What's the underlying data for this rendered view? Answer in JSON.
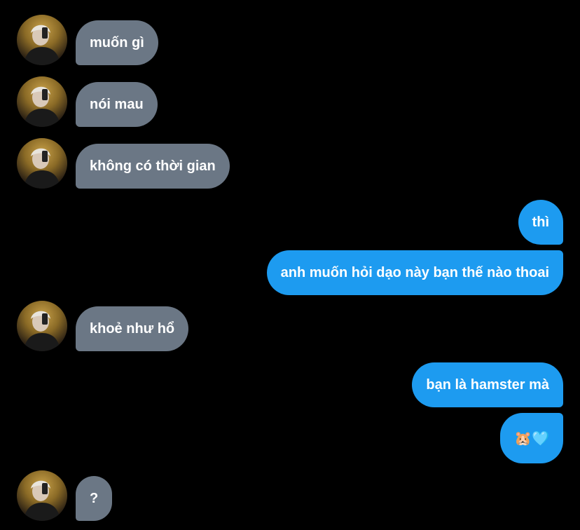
{
  "colors": {
    "background": "#000000",
    "incoming_bubble": "#6b7785",
    "outgoing_bubble": "#1d9bf0",
    "text": "#ffffff"
  },
  "messages": [
    {
      "direction": "incoming",
      "text": "muốn gì"
    },
    {
      "direction": "incoming",
      "text": "nói mau"
    },
    {
      "direction": "incoming",
      "text": "không có thời gian"
    },
    {
      "direction": "outgoing",
      "text": "thì"
    },
    {
      "direction": "outgoing",
      "text": "anh muốn hỏi dạo này bạn thế nào thoai"
    },
    {
      "direction": "incoming",
      "text": "khoẻ như hổ"
    },
    {
      "direction": "outgoing",
      "text": "bạn là hamster mà"
    },
    {
      "direction": "outgoing",
      "text": "🐹🩵"
    },
    {
      "direction": "incoming",
      "text": "?"
    }
  ],
  "avatar": {
    "icon": "user-avatar-photo"
  }
}
